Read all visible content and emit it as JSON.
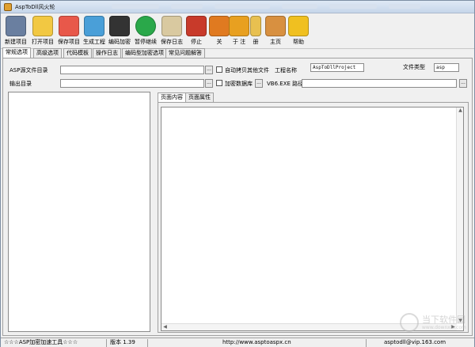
{
  "window": {
    "title": "AspToDll风火轮"
  },
  "toolbar": {
    "buttons": [
      {
        "label": "新建项目",
        "color": "#6a7fa0"
      },
      {
        "label": "打开项目",
        "color": "#f2c842"
      },
      {
        "label": "保存项目",
        "color": "#e8584a"
      },
      {
        "label": "生成工程",
        "color": "#4a9fd8"
      },
      {
        "label": "编码加密",
        "color": "#333333"
      },
      {
        "label": "暂停继续",
        "color": "#2aa84a"
      },
      {
        "label": "保存日志",
        "color": "#d9c9a0"
      },
      {
        "label": "停止",
        "color": "#c83a2a"
      },
      {
        "label": "关",
        "color": "#e07a20"
      },
      {
        "label": "于 注",
        "color": "#e8a020"
      },
      {
        "label": "册",
        "color": "#e8c050"
      },
      {
        "label": "主页",
        "color": "#d89040"
      },
      {
        "label": "帮助",
        "color": "#f0c020"
      }
    ]
  },
  "tabs": [
    "常规选项",
    "高级选项",
    "代码模板",
    "操作日志",
    "编码型加密选项",
    "常见问题解答"
  ],
  "form": {
    "asp_source_label": "ASP源文件目录",
    "asp_source_value": "",
    "output_label": "输出目录",
    "output_value": "",
    "browse_label": "...",
    "auto_copy_label": "自动拷贝其他文件",
    "encrypt_db_label": "加密数据库",
    "vb6_label": "VB6.EXE 路径",
    "vb6_value": "",
    "project_name_label": "工程名称",
    "project_name_value": "AspToDllProject",
    "file_type_label": "文件类型",
    "file_type_value": "asp"
  },
  "subtabs": [
    "页面内容",
    "页面属性"
  ],
  "statusbar": {
    "tool_name": "☆☆☆ASP加密加速工具☆☆☆",
    "version": "版本 1.39",
    "website": "http://www.asptoaspx.cn",
    "email": "asptodll@vip.163.com"
  },
  "watermark": {
    "text": "当下软件园",
    "url": "www.downxia.com"
  }
}
